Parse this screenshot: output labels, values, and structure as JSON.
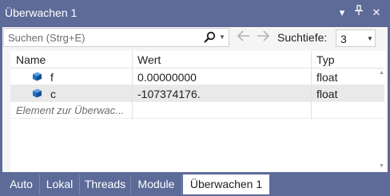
{
  "window": {
    "title": "Überwachen 1",
    "controls": {
      "dropdown": "▾",
      "pin": "⊥",
      "close": "✕"
    }
  },
  "toolbar": {
    "search_placeholder": "Suchen (Strg+E)",
    "search_icon": "search-icon",
    "back_icon": "arrow-left-icon",
    "forward_icon": "arrow-right-icon",
    "depth_label": "Suchtiefe:",
    "depth_value": "3"
  },
  "grid": {
    "columns": [
      "Name",
      "Wert",
      "Typ"
    ],
    "rows": [
      {
        "icon": "variable-cube-icon",
        "name": "f",
        "value": "0.00000000",
        "type": "float"
      },
      {
        "icon": "variable-cube-icon",
        "name": "c",
        "value": "-107374176.",
        "type": "float"
      }
    ],
    "add_placeholder": "Element zur Überwac..."
  },
  "tabs": [
    {
      "label": "Auto",
      "active": false
    },
    {
      "label": "Lokal",
      "active": false
    },
    {
      "label": "Threads",
      "active": false
    },
    {
      "label": "Module",
      "active": false
    },
    {
      "label": "Überwachen 1",
      "active": true
    }
  ],
  "colors": {
    "frame": "#5d6b99",
    "icon_blue": "#1f6fbf",
    "selected_row": "#e9e9e9"
  }
}
